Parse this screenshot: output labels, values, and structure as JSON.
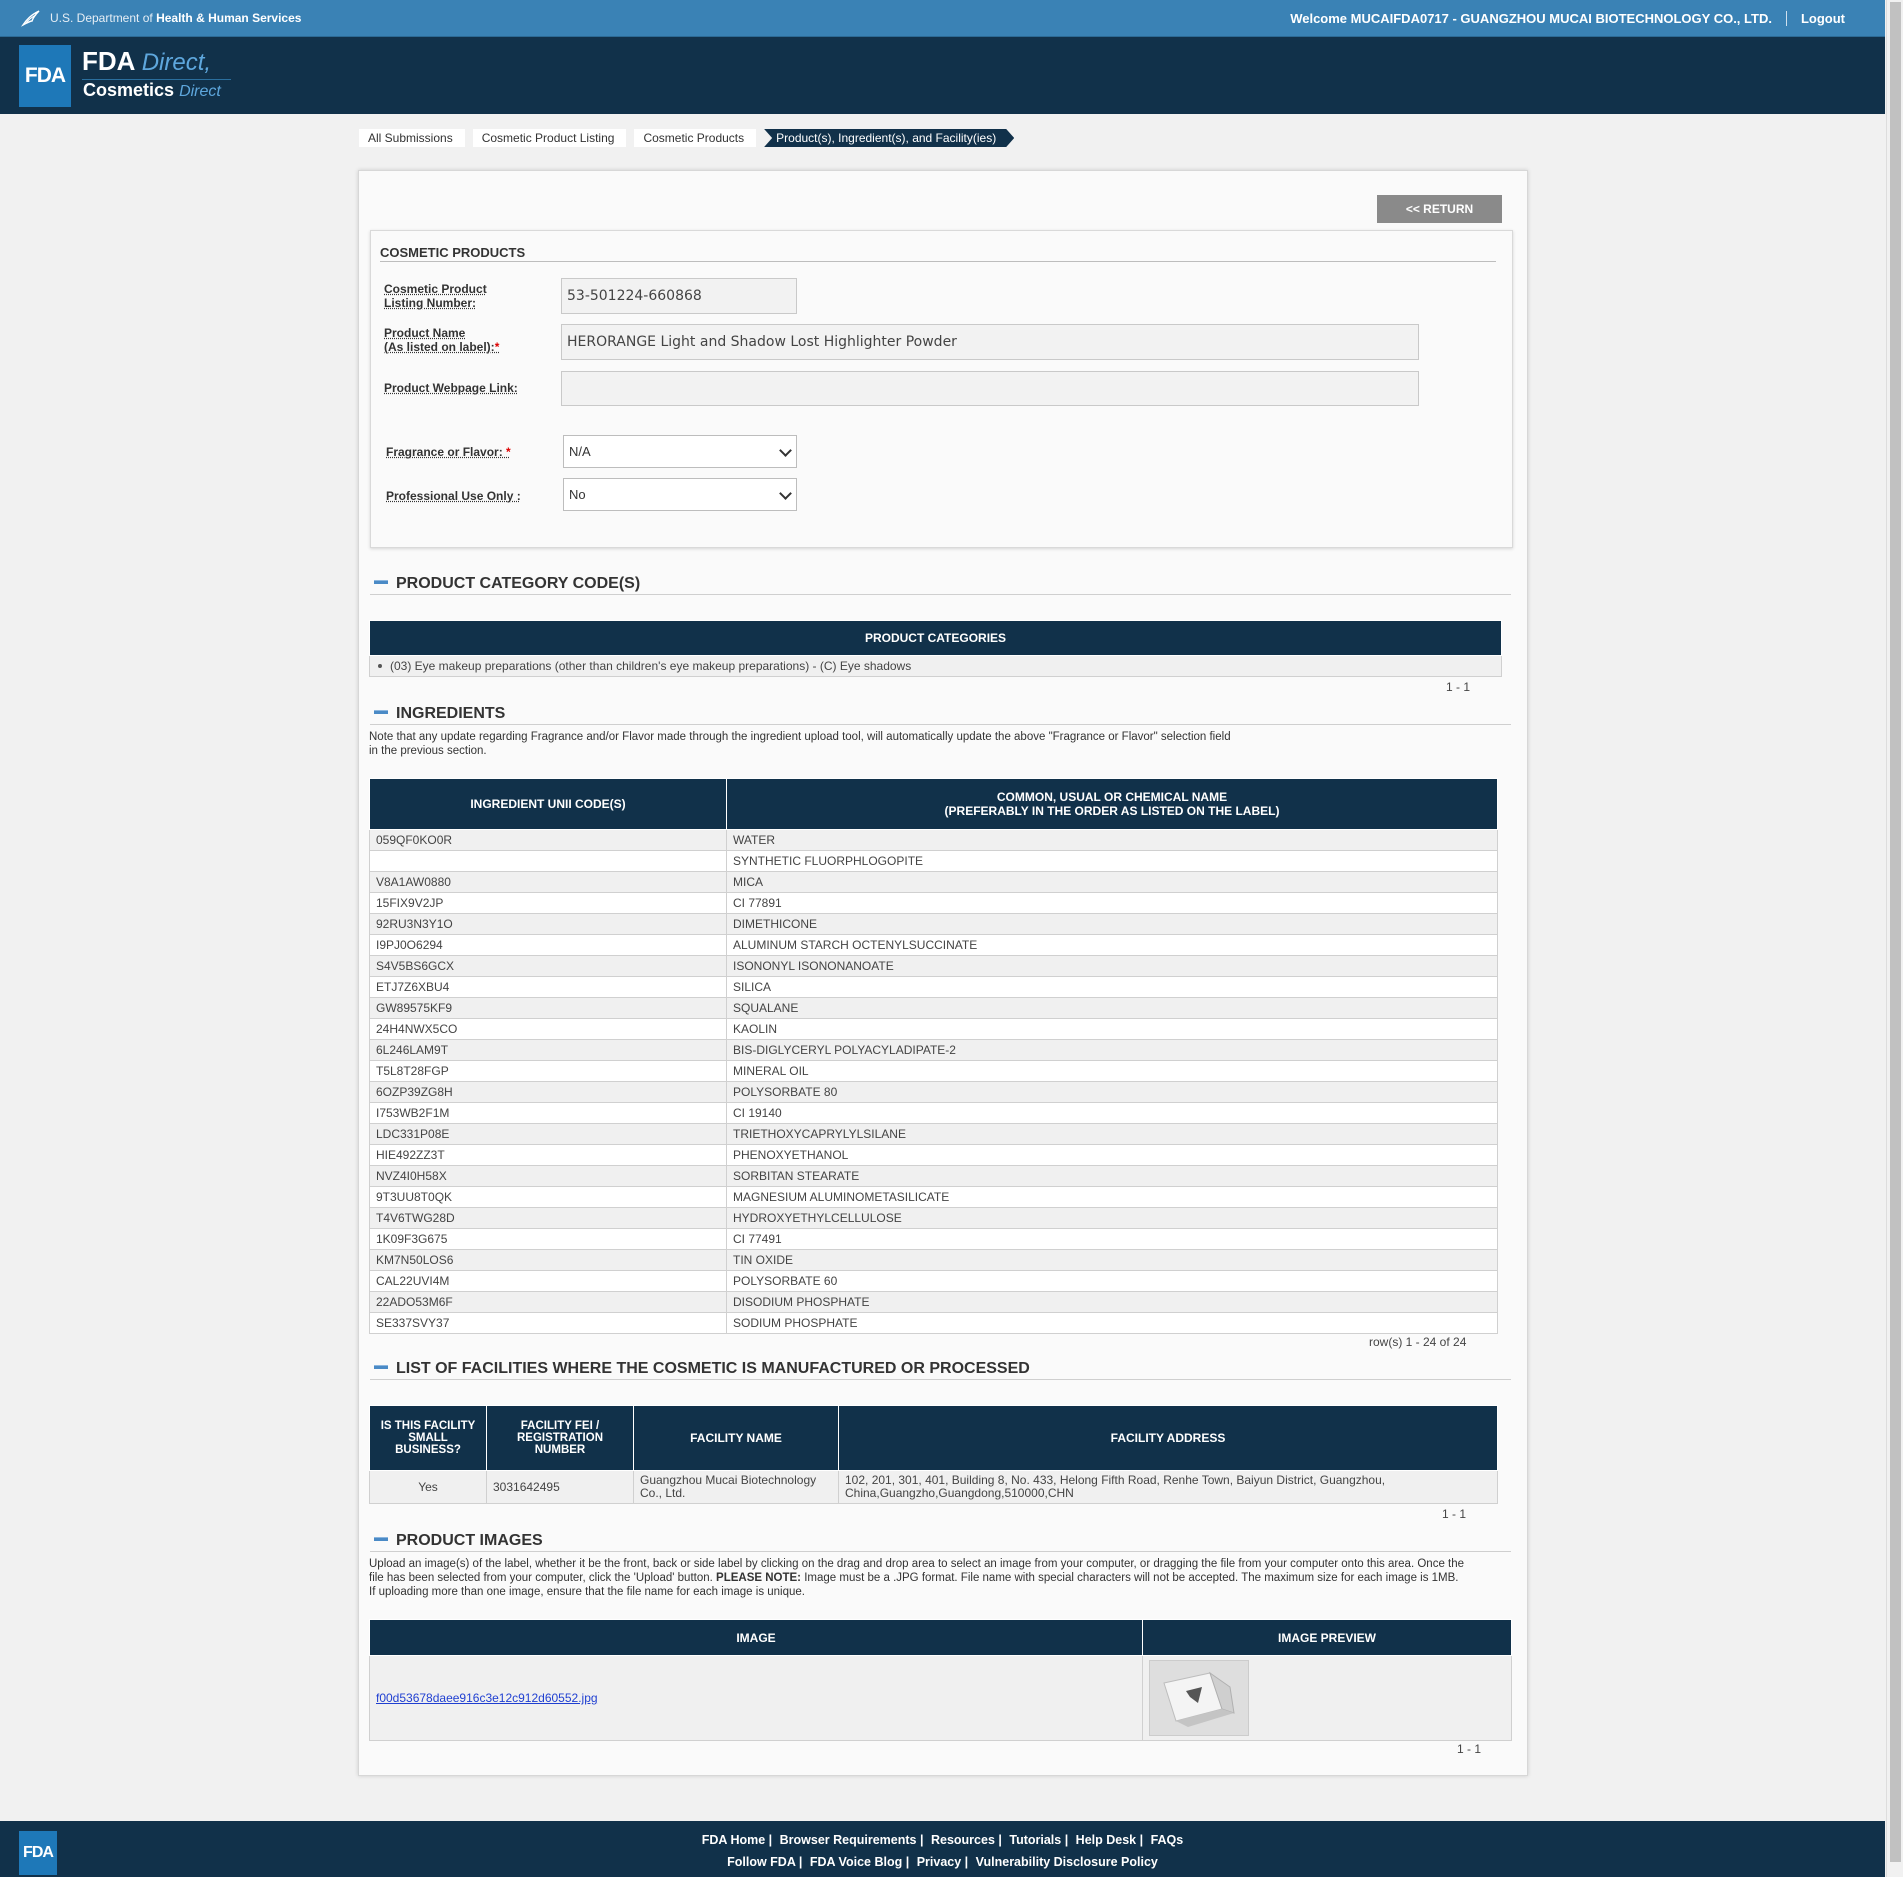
{
  "hhs": {
    "dept_prefix": "U.S. Department of",
    "dept_name": "Health & Human Services",
    "welcome": "Welcome MUCAIFDA0717 - GUANGZHOU MUCAI BIOTECHNOLOGY CO., LTD.",
    "logout": "Logout"
  },
  "brand": {
    "logo": "FDA",
    "line1_bold": "FDA",
    "line1_italic": "Direct",
    "line2_bold": "Cosmetics",
    "line2_italic": "Direct"
  },
  "breadcrumb": [
    {
      "label": "All Submissions"
    },
    {
      "label": "Cosmetic Product Listing"
    },
    {
      "label": "Cosmetic Products"
    },
    {
      "label": "Product(s), Ingredient(s), and Facility(ies)"
    }
  ],
  "return_label": "<< RETURN",
  "products": {
    "title": "COSMETIC PRODUCTS",
    "listing_label_1": "Cosmetic Product",
    "listing_label_2": "Listing Number:",
    "listing_value": "53-501224-660868",
    "name_label_1": "Product Name",
    "name_label_2": "(As listed on label):",
    "name_value": "HERORANGE Light and Shadow Lost Highlighter Powder",
    "webpage_label": "Product Webpage Link:",
    "webpage_value": "",
    "fragrance_label": "Fragrance or Flavor:",
    "fragrance_value": "N/A",
    "professional_label": "Professional Use Only :",
    "professional_value": "No",
    "required_mark": "*"
  },
  "categories": {
    "heading": "PRODUCT CATEGORY CODE(S)",
    "column": "PRODUCT CATEGORIES",
    "items": [
      "(03) Eye makeup preparations (other than children's eye makeup preparations) - (C) Eye shadows"
    ],
    "pager": "1 - 1"
  },
  "ingredients": {
    "heading": "INGREDIENTS",
    "note_1": "Note that any update regarding Fragrance and/or Flavor made through the ingredient upload tool, will automatically update the above \"Fragrance or Flavor\" selection field",
    "note_2": "in the previous section.",
    "col_code": "INGREDIENT UNII CODE(S)",
    "col_name_1": "COMMON, USUAL OR CHEMICAL NAME",
    "col_name_2": "(PREFERABLY IN THE ORDER AS LISTED ON THE LABEL)",
    "rows": [
      [
        "059QF0KO0R",
        "WATER"
      ],
      [
        "",
        "SYNTHETIC FLUORPHLOGOPITE"
      ],
      [
        "V8A1AW0880",
        "MICA"
      ],
      [
        "15FIX9V2JP",
        "CI 77891"
      ],
      [
        "92RU3N3Y1O",
        "DIMETHICONE"
      ],
      [
        "I9PJ0O6294",
        "ALUMINUM STARCH OCTENYLSUCCINATE"
      ],
      [
        "S4V5BS6GCX",
        "ISONONYL ISONONANOATE"
      ],
      [
        "ETJ7Z6XBU4",
        "SILICA"
      ],
      [
        "GW89575KF9",
        "SQUALANE"
      ],
      [
        "24H4NWX5CO",
        "KAOLIN"
      ],
      [
        "6L246LAM9T",
        "BIS-DIGLYCERYL POLYACYLADIPATE-2"
      ],
      [
        "T5L8T28FGP",
        "MINERAL OIL"
      ],
      [
        "6OZP39ZG8H",
        "POLYSORBATE 80"
      ],
      [
        "I753WB2F1M",
        "CI 19140"
      ],
      [
        "LDC331P08E",
        "TRIETHOXYCAPRYLYLSILANE"
      ],
      [
        "HIE492ZZ3T",
        "PHENOXYETHANOL"
      ],
      [
        "NVZ4I0H58X",
        "SORBITAN STEARATE"
      ],
      [
        "9T3UU8T0QK",
        "MAGNESIUM ALUMINOMETASILICATE"
      ],
      [
        "T4V6TWG28D",
        "HYDROXYETHYLCELLULOSE"
      ],
      [
        "1K09F3G675",
        "CI 77491"
      ],
      [
        "KM7N50LOS6",
        "TIN OXIDE"
      ],
      [
        "CAL22UVI4M",
        "POLYSORBATE 60"
      ],
      [
        "22ADO53M6F",
        "DISODIUM PHOSPHATE"
      ],
      [
        "SE337SVY37",
        "SODIUM PHOSPHATE"
      ]
    ],
    "pager": "row(s) 1 - 24 of 24"
  },
  "facilities": {
    "heading": "LIST OF FACILITIES WHERE THE COSMETIC IS MANUFACTURED OR PROCESSED",
    "col_small_1": "IS THIS FACILITY",
    "col_small_2": "SMALL",
    "col_small_3": "BUSINESS?",
    "col_fei_1": "FACILITY FEI /",
    "col_fei_2": "REGISTRATION",
    "col_fei_3": "NUMBER",
    "col_name": "FACILITY NAME",
    "col_address": "FACILITY ADDRESS",
    "row": {
      "small": "Yes",
      "fei": "3031642495",
      "name_1": "Guangzhou Mucai Biotechnology",
      "name_2": "Co., Ltd.",
      "address_1": "102, 201, 301, 401, Building 8, No. 433, Helong Fifth Road, Renhe Town, Baiyun District, Guangzhou,",
      "address_2": "China,Guangzho,Guangdong,510000,CHN"
    },
    "pager": "1 - 1"
  },
  "images": {
    "heading": "PRODUCT IMAGES",
    "note_1": "Upload an image(s) of the label, whether it be the front, back or side label by clicking on the drag and drop area to select an image from your computer, or dragging the file from your computer onto this area. Once the",
    "note_2_pre": "file has been selected from your computer, click the 'Upload' button.",
    "note_2_bold": "PLEASE NOTE:",
    "note_2_post": "Image must be a .JPG format. File name with special characters will not be accepted. The maximum size for each image is 1MB.",
    "note_3": "If uploading more than one image, ensure that the file name for each image is unique.",
    "col_image": "IMAGE",
    "col_preview": "IMAGE PREVIEW",
    "file_name": "f00d53678daee916c3e12c912d60552.jpg",
    "pager": "1 - 1"
  },
  "footer": {
    "logo": "FDA",
    "row1": [
      "FDA Home |",
      "Browser Requirements |",
      "Resources |",
      "Tutorials |",
      "Help Desk |",
      "FAQs"
    ],
    "row2": [
      "Follow FDA |",
      "FDA Voice Blog |",
      "Privacy |",
      "Vulnerability Disclosure Policy"
    ]
  },
  "colors": {
    "hhs_bar": "#3a82b5",
    "navy": "#11314a",
    "fda_blue": "#1e78b8",
    "required": "#dd0000"
  }
}
